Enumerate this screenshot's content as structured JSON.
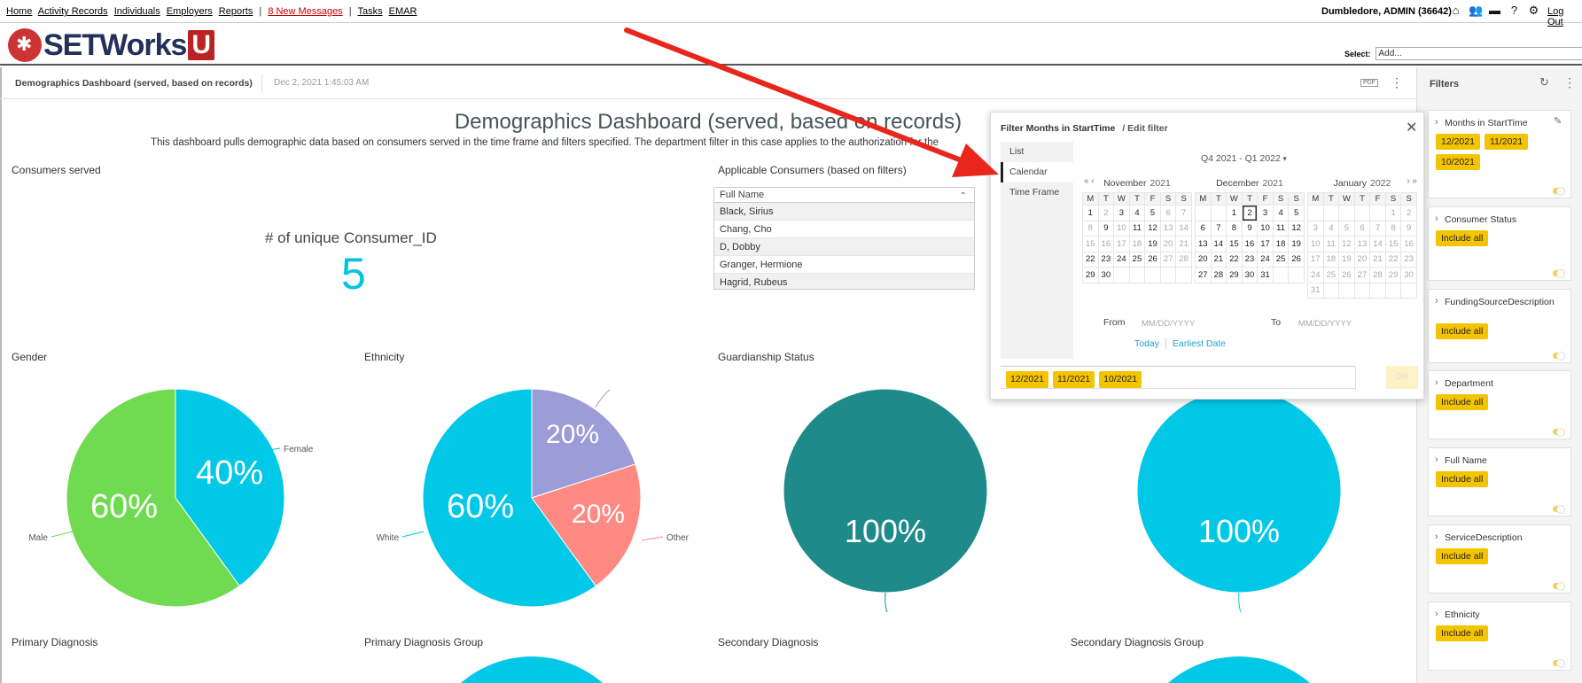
{
  "topnav": {
    "links": [
      "Home",
      "Activity Records",
      "Individuals",
      "Employers",
      "Reports"
    ],
    "messages": "8 New Messages",
    "links2": [
      "Tasks",
      "EMAR"
    ],
    "user": "Dumbledore, ADMIN  (36642)",
    "logout": "Log Out"
  },
  "logo": {
    "word": "SETWorks",
    "u": "U"
  },
  "select": {
    "label": "Select:",
    "value": "Add..."
  },
  "dashboard": {
    "title": "Demographics Dashboard (served, based on records)",
    "timestamp": "Dec 2, 2021 1:45:03 AM",
    "pdf": "PDF",
    "main_title": "Demographics Dashboard (served, based on records)",
    "description": "This dashboard pulls demographic data based on consumers served in the time frame and filters specified. The department filter in this case applies to the authorization for the"
  },
  "widgets": {
    "consumers_served": "Consumers served",
    "kpi_label": "# of unique Consumer_ID",
    "kpi_value": "5",
    "applicable": "Applicable Consumers (based on filters)",
    "table_header": "Full Name",
    "table_rows": [
      "Black, Sirius",
      "Chang, Cho",
      "D, Dobby",
      "Granger, Hermione",
      "Hagrid, Rubeus"
    ],
    "gender": "Gender",
    "ethnicity": "Ethnicity",
    "guardianship": "Guardianship Status",
    "primary_dx": "Primary Diagnosis",
    "primary_dx_group": "Primary Diagnosis Group",
    "secondary_dx": "Secondary Diagnosis",
    "secondary_dx_group": "Secondary Diagnosis Group"
  },
  "chart_data": [
    {
      "type": "pie",
      "title": "Gender",
      "series": [
        {
          "name": "Female",
          "value": 40,
          "color": "#00c8e6",
          "label": "40%"
        },
        {
          "name": "Male",
          "value": 60,
          "color": "#70db50",
          "label": "60%"
        }
      ]
    },
    {
      "type": "pie",
      "title": "Ethnicity",
      "series": [
        {
          "name": "",
          "value": 20,
          "color": "#9c9cd8",
          "label": "20%"
        },
        {
          "name": "Other",
          "value": 20,
          "color": "#ff8a84",
          "label": "20%"
        },
        {
          "name": "White",
          "value": 60,
          "color": "#00c8e6",
          "label": "60%"
        }
      ]
    },
    {
      "type": "pie",
      "title": "Guardianship Status",
      "series": [
        {
          "name": "",
          "value": 100,
          "color": "#1f8a8a",
          "label": "100%"
        }
      ]
    },
    {
      "type": "pie",
      "title": "",
      "series": [
        {
          "name": "",
          "value": 100,
          "color": "#00c8e6",
          "label": "100%"
        }
      ]
    }
  ],
  "filters": {
    "title": "Filters",
    "cards": [
      {
        "name": "Months in StartTime",
        "chips": [
          "12/2021",
          "11/2021",
          "10/2021"
        ]
      },
      {
        "name": "Consumer Status",
        "chips": [
          "Include all"
        ]
      },
      {
        "name": "FundingSourceDescription",
        "chips": [
          "Include all"
        ]
      },
      {
        "name": "Department",
        "chips": [
          "Include all"
        ]
      },
      {
        "name": "Full Name",
        "chips": [
          "Include all"
        ]
      },
      {
        "name": "ServiceDescription",
        "chips": [
          "Include all"
        ]
      },
      {
        "name": "Ethnicity",
        "chips": [
          "Include all"
        ]
      }
    ]
  },
  "popup": {
    "title": "Filter Months in StartTime",
    "edit": "/ Edit filter",
    "tabs": [
      "List",
      "Calendar",
      "Time Frame"
    ],
    "active_tab": "Calendar",
    "range": "Q4 2021 - Q1 2022",
    "dow": [
      "M",
      "T",
      "W",
      "T",
      "F",
      "S",
      "S"
    ],
    "months": [
      {
        "name": "November",
        "year": "2021",
        "weeks": [
          [
            "1",
            "2",
            "3",
            "4",
            "5",
            "6",
            "7"
          ],
          [
            "8",
            "9",
            "10",
            "11",
            "12",
            "13",
            "14"
          ],
          [
            "15",
            "16",
            "17",
            "18",
            "19",
            "20",
            "21"
          ],
          [
            "22",
            "23",
            "24",
            "25",
            "26",
            "27",
            "28"
          ],
          [
            "29",
            "30",
            "",
            "",
            "",
            "",
            ""
          ]
        ]
      },
      {
        "name": "December",
        "year": "2021",
        "weeks": [
          [
            "",
            "",
            "1",
            "2",
            "3",
            "4",
            "5"
          ],
          [
            "6",
            "7",
            "8",
            "9",
            "10",
            "11",
            "12"
          ],
          [
            "13",
            "14",
            "15",
            "16",
            "17",
            "18",
            "19"
          ],
          [
            "20",
            "21",
            "22",
            "23",
            "24",
            "25",
            "26"
          ],
          [
            "27",
            "28",
            "29",
            "30",
            "31",
            "",
            ""
          ]
        ]
      },
      {
        "name": "January",
        "year": "2022",
        "weeks": [
          [
            "",
            "",
            "",
            "",
            "",
            "1",
            "2"
          ],
          [
            "3",
            "4",
            "5",
            "6",
            "7",
            "8",
            "9"
          ],
          [
            "10",
            "11",
            "12",
            "13",
            "14",
            "15",
            "16"
          ],
          [
            "17",
            "18",
            "19",
            "20",
            "21",
            "22",
            "23"
          ],
          [
            "24",
            "25",
            "26",
            "27",
            "28",
            "29",
            "30"
          ],
          [
            "31",
            "",
            "",
            "",
            "",
            "",
            ""
          ]
        ]
      }
    ],
    "from_label": "From",
    "from_placeholder": "MM/DD/YYYY",
    "to_label": "To",
    "to_placeholder": "MM/DD/YYYY",
    "today": "Today",
    "earliest": "Earliest Date",
    "selected": [
      "12/2021",
      "11/2021",
      "10/2021"
    ],
    "ok": "OK"
  },
  "colors": {
    "accent": "#00c5e0",
    "chip": "#f5c400",
    "arrow": "#e8261c"
  }
}
